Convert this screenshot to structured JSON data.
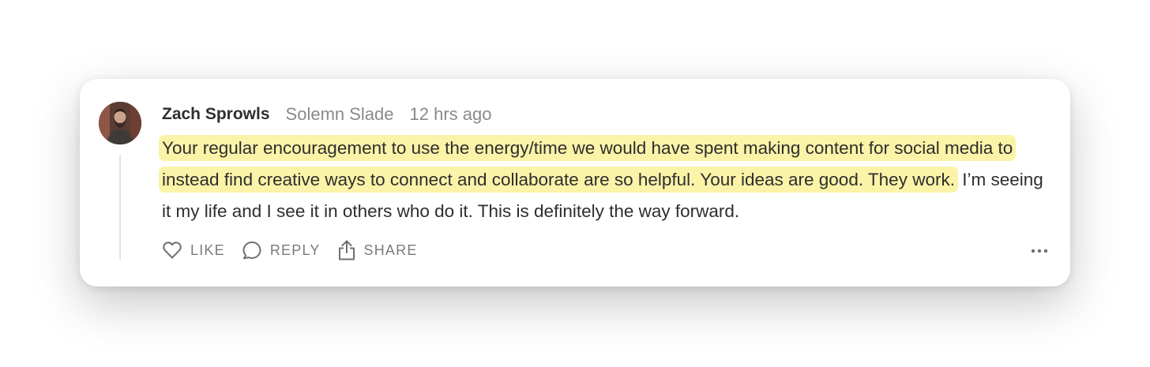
{
  "comment": {
    "author": "Zach Sprowls",
    "publication": "Solemn Slade",
    "timestamp": "12 hrs ago",
    "highlighted_text": "Your regular encouragement to use the energy/time we would have spent making content for social media to instead find creative ways to connect and collaborate are so helpful. Your ideas are good. They work.",
    "rest_text": " I’m seeing it my life and I see it in others who do it. This is definitely the way forward."
  },
  "actions": {
    "like_label": "LIKE",
    "reply_label": "REPLY",
    "share_label": "SHARE"
  },
  "icons": {
    "like": "heart-icon",
    "reply": "speech-bubble-icon",
    "share": "share-icon",
    "more": "ellipsis-icon"
  },
  "colors": {
    "highlight": "#fbf3a8",
    "author": "#2f2f2f",
    "muted": "#8a8a8a",
    "body_text": "#2e2e2e"
  }
}
